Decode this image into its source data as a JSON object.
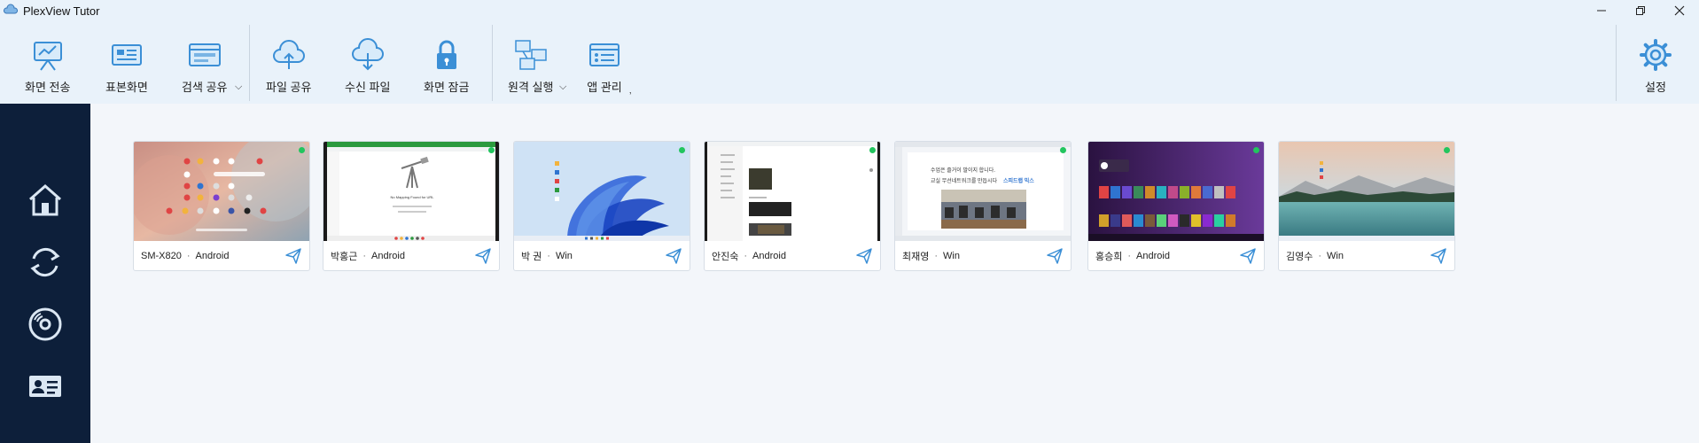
{
  "window": {
    "title": "PlexView Tutor"
  },
  "toolbar": {
    "items": [
      {
        "label": "화면 전송",
        "icon": "screen-send-icon"
      },
      {
        "label": "표본화면",
        "icon": "sample-screen-icon"
      },
      {
        "label": "검색 공유",
        "icon": "search-share-icon"
      },
      {
        "label": "파일 공유",
        "icon": "cloud-upload-icon"
      },
      {
        "label": "수신 파일",
        "icon": "cloud-download-icon"
      },
      {
        "label": "화면 잠금",
        "icon": "lock-icon"
      },
      {
        "label": "원격 실행",
        "icon": "remote-run-icon"
      },
      {
        "label": "앱 관리",
        "icon": "app-manage-icon"
      }
    ],
    "settings_label": "설정"
  },
  "sidebar": {
    "items": [
      {
        "icon": "home-icon"
      },
      {
        "icon": "refresh-icon"
      },
      {
        "icon": "disc-icon"
      },
      {
        "icon": "contact-card-icon"
      }
    ]
  },
  "devices": [
    {
      "name": "SM-X820",
      "os": "Android"
    },
    {
      "name": "박홍근",
      "os": "Android"
    },
    {
      "name": "박 권",
      "os": "Win"
    },
    {
      "name": "안진숙",
      "os": "Android"
    },
    {
      "name": "최재영",
      "os": "Win"
    },
    {
      "name": "홍승희",
      "os": "Android"
    },
    {
      "name": "김영수",
      "os": "Win"
    }
  ],
  "thumb_text": {
    "telescope_msg": "No Mapping Found for URL",
    "class_line1": "수업은 즐거이 말이지 합니다.",
    "class_line2": "교실 무선네트워크를 만듭시다",
    "class_brand": "스피드랩 믹스"
  },
  "colors": {
    "accent": "#3b8fd6",
    "sidebar": "#0d1f3a",
    "online": "#22c55e"
  }
}
